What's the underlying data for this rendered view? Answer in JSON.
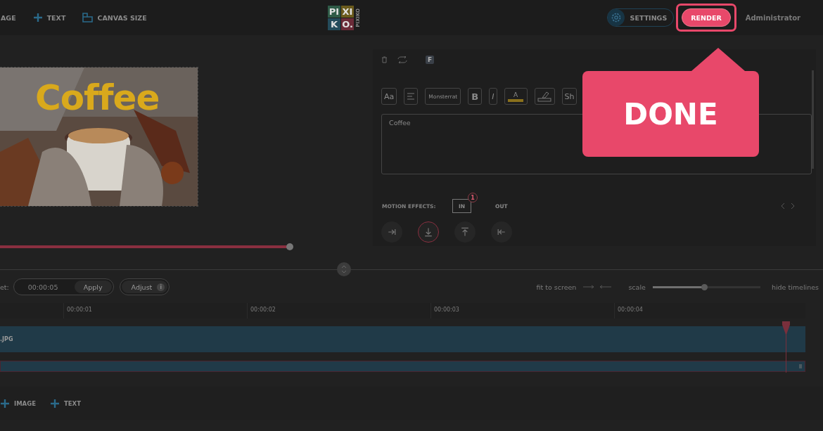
{
  "toolbar": [
    {
      "kind": "plain",
      "label": "AGE"
    },
    {
      "kind": "add",
      "label": "TEXT"
    },
    {
      "kind": "canvas",
      "label": "CANVAS SIZE"
    }
  ],
  "logo": {
    "tiles": [
      {
        "label": "PI",
        "color": "#2f5b47"
      },
      {
        "label": "XI",
        "color": "#6b5b1c"
      },
      {
        "label": "K",
        "color": "#244b5b"
      },
      {
        "label": "O.",
        "color": "#6b2b38"
      }
    ],
    "wordmark": "PIXIKO"
  },
  "settings": "SETTINGS",
  "render": "RENDER",
  "user": "Administrator",
  "preview": {
    "caption": "Coffee",
    "level": 0.97
  },
  "editor": {
    "badge": "F",
    "tools": [
      {
        "kind": "text",
        "label": "Aa"
      },
      {
        "kind": "align"
      },
      {
        "kind": "font",
        "label": "Monsterrat"
      },
      {
        "kind": "text",
        "label": "B"
      },
      {
        "kind": "italic",
        "label": "I"
      },
      {
        "kind": "color",
        "label": "A"
      },
      {
        "kind": "eraser"
      },
      {
        "kind": "text",
        "label": "Sh"
      }
    ],
    "text": "Coffee",
    "motion_label": "MOTION EFFECTS:",
    "tabs": [
      {
        "label": "IN",
        "badge": "1",
        "selected": true
      },
      {
        "label": "OUT",
        "selected": false
      }
    ],
    "effects": [
      {
        "kind": "right",
        "selected": false
      },
      {
        "kind": "down",
        "selected": true
      },
      {
        "kind": "up",
        "selected": false
      },
      {
        "kind": "left",
        "selected": false
      }
    ]
  },
  "timeline": {
    "duration_label": "et:",
    "duration": "00:00:05",
    "apply": "Apply",
    "adjust": "Adjust",
    "info": "i",
    "fit": "fit to screen",
    "scale_label": "scale",
    "scale": {
      "level": 0.48
    },
    "hide": "hide timelines",
    "ticks": [
      "00:00:01",
      "00:00:02",
      "00:00:03",
      "00:00:04"
    ],
    "track": ".JPG"
  },
  "bottom": [
    {
      "kind": "add",
      "label": "IMAGE"
    },
    {
      "kind": "add",
      "label": "TEXT"
    }
  ],
  "callout": "DONE"
}
